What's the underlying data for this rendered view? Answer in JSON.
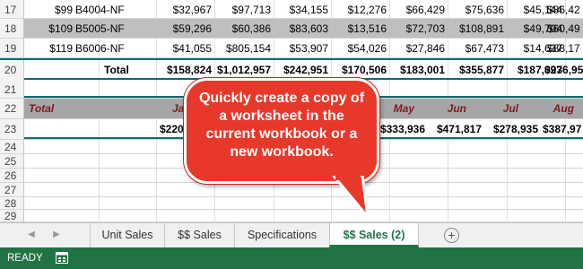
{
  "rows": [
    {
      "num": "17",
      "cells": [
        "$99",
        "B4004-NF",
        "$32,967",
        "$97,713",
        "$34,155",
        "$12,276",
        "$66,429",
        "$75,636",
        "$45,144",
        "$86,42"
      ]
    },
    {
      "num": "18",
      "cells": [
        "$109",
        "B5005-NF",
        "$59,296",
        "$60,386",
        "$83,603",
        "$13,516",
        "$72,703",
        "$108,891",
        "$49,704",
        "$60,49"
      ]
    },
    {
      "num": "19",
      "cells": [
        "$119",
        "B6006-NF",
        "$41,055",
        "$805,154",
        "$53,907",
        "$54,026",
        "$27,846",
        "$67,473",
        "$14,637",
        "$88,17"
      ]
    },
    {
      "num": "20",
      "label": "Total",
      "cells": [
        "$158,824",
        "$1,012,957",
        "$242,951",
        "$170,506",
        "$183,001",
        "$355,877",
        "$187,093",
        "$276,95"
      ]
    },
    {
      "num": "21"
    },
    {
      "num": "22",
      "label": "Total",
      "months": [
        "Ja",
        "May",
        "Jun",
        "Jul",
        "Aug"
      ]
    },
    {
      "num": "23",
      "cells": [
        "$220",
        "$333,936",
        "$471,817",
        "$278,935",
        "$387,97"
      ]
    },
    {
      "num": "24"
    },
    {
      "num": "25"
    },
    {
      "num": "26"
    },
    {
      "num": "27"
    },
    {
      "num": "28"
    },
    {
      "num": "29"
    }
  ],
  "callout": {
    "text": "Quickly create a copy of a worksheet in the current workbook or a new workbook."
  },
  "tabs": {
    "prev": "◀",
    "next": "▶",
    "items": [
      {
        "label": "Unit Sales"
      },
      {
        "label": "$$ Sales"
      },
      {
        "label": "Specifications"
      },
      {
        "label": "$$ Sales (2)"
      }
    ],
    "add": "+"
  },
  "status": {
    "ready": "READY"
  },
  "colors": {
    "excel_green": "#217346",
    "callout_red": "#e8382a",
    "teal_border": "#0e6b6b",
    "maroon_text": "#7b1c1c"
  }
}
